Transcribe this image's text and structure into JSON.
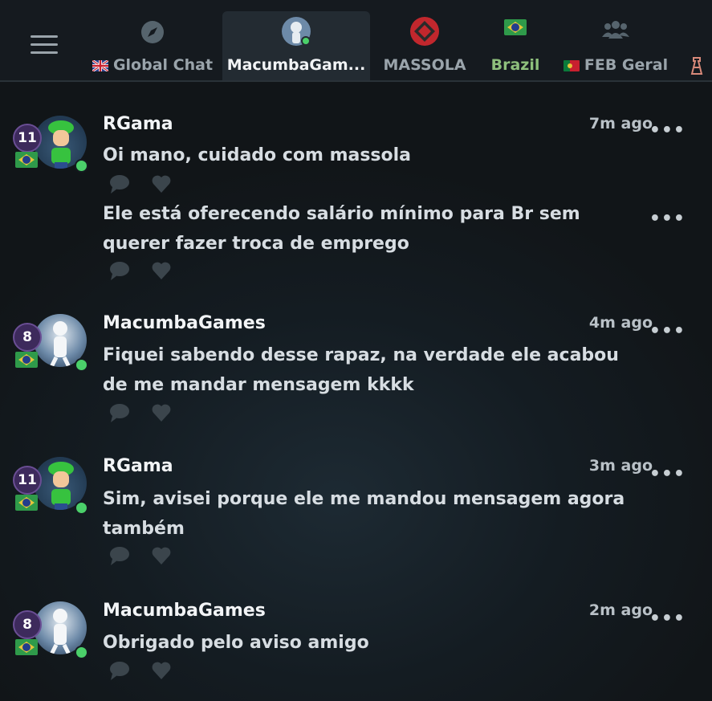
{
  "tabs": [
    {
      "label": "Global Chat",
      "icon": "compass-icon",
      "flag": "uk"
    },
    {
      "label": "MacumbaGam...",
      "icon": "avatar-icon",
      "active": true
    },
    {
      "label": "MASSOLA",
      "icon": "massola-logo-icon"
    },
    {
      "label": "Brazil",
      "icon": "brazil-flag-icon"
    },
    {
      "label": "FEB Geral",
      "icon": "group-icon",
      "flag": "portugal"
    }
  ],
  "messages": [
    {
      "user": "RGama",
      "level": "11",
      "time": "7m ago",
      "text": "Oi mano, cuidado com massola"
    },
    {
      "user": "",
      "level": "",
      "time": "",
      "text": "Ele está oferecendo salário mínimo para Br sem querer fazer troca de emprego"
    },
    {
      "user": "MacumbaGames",
      "level": "8",
      "time": "4m ago",
      "text": "Fiquei sabendo desse rapaz, na verdade ele acabou de me mandar mensagem kkkk"
    },
    {
      "user": "RGama",
      "level": "11",
      "time": "3m ago",
      "text": "Sim, avisei porque ele me mandou mensagem agora também"
    },
    {
      "user": "MacumbaGames",
      "level": "8",
      "time": "2m ago",
      "text": "Obrigado pelo aviso amigo"
    }
  ],
  "colors": {
    "accent_green": "#8ec07c",
    "online": "#4bd06a",
    "level_badge": "#3d2a5c"
  }
}
